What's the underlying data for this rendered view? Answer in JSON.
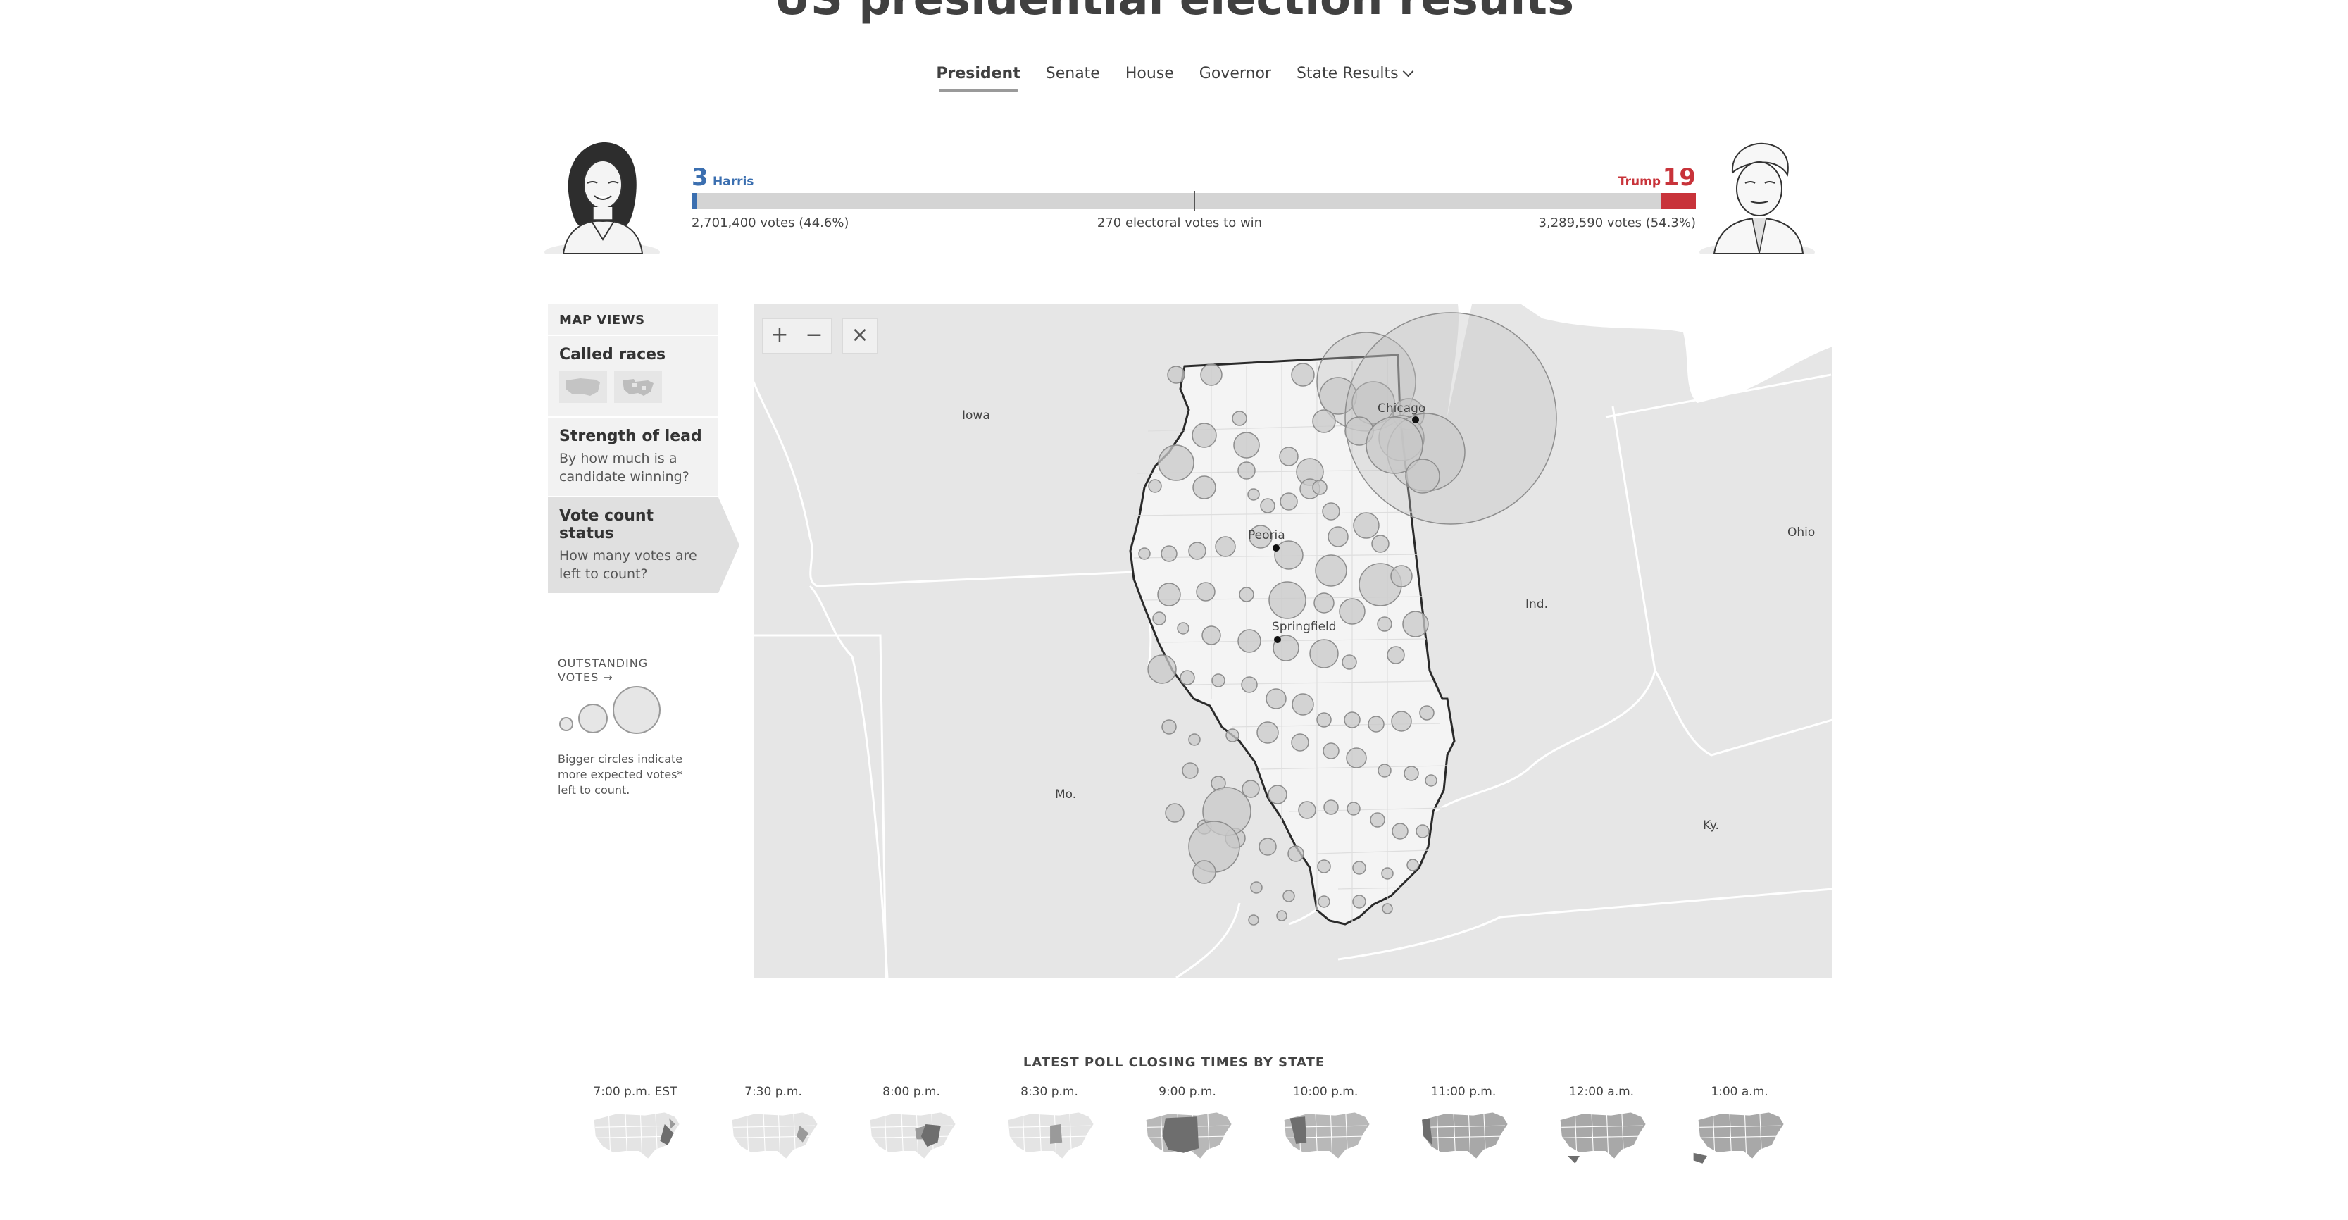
{
  "page": {
    "title": "US presidential election results"
  },
  "tabs": [
    {
      "label": "President",
      "active": true
    },
    {
      "label": "Senate"
    },
    {
      "label": "House"
    },
    {
      "label": "Governor"
    },
    {
      "label": "State Results"
    }
  ],
  "scoreboard": {
    "harris": {
      "electoral": "3",
      "name": "Harris",
      "votes": "2,701,400 votes (44.6%)",
      "color": "#3b6fb0"
    },
    "trump": {
      "electoral": "19",
      "name": "Trump",
      "votes": "3,289,590 votes (54.3%)",
      "color": "#c8333a"
    },
    "threshold": "270 electoral votes to win"
  },
  "sidebar": {
    "header": "MAP VIEWS",
    "items": [
      {
        "title": "Called races",
        "desc": ""
      },
      {
        "title": "Strength of lead",
        "desc": "By how much is a candidate winning?"
      },
      {
        "title": "Vote count status",
        "desc": "How many votes are left to count?",
        "active": true
      }
    ]
  },
  "legend": {
    "label_line1": "OUTSTANDING",
    "label_line2": "VOTES →",
    "note": "Bigger circles indicate more expected votes* left to count."
  },
  "map": {
    "controls": {
      "zoom_in": "+",
      "zoom_out": "−",
      "reset": "×"
    },
    "states": [
      "Iowa",
      "Mo.",
      "Ind.",
      "Ohio",
      "Ky."
    ],
    "cities": [
      "Chicago",
      "Peoria",
      "Springfield"
    ]
  },
  "poll_closing": {
    "title": "LATEST POLL CLOSING TIMES BY STATE",
    "times": [
      "7:00 p.m. EST",
      "7:30 p.m.",
      "8:00 p.m.",
      "8:30 p.m.",
      "9:00 p.m.",
      "10:00 p.m.",
      "11:00 p.m.",
      "12:00 a.m.",
      "1:00 a.m."
    ]
  }
}
